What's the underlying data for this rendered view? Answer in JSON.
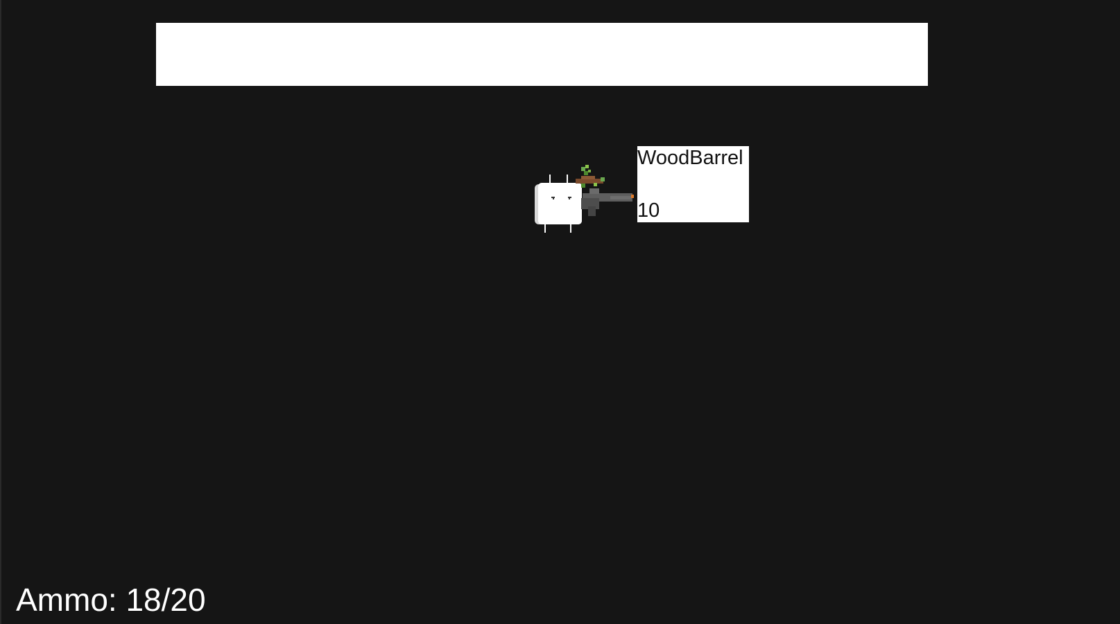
{
  "hud": {
    "ammo_label": "Ammo: 18/20"
  },
  "item_tooltip": {
    "name": "WoodBarrel",
    "value": "10"
  },
  "player": {
    "icon": "marshmallow-player-icon",
    "weapon_icon": "rifle-icon",
    "attachment_icon": "wood-barrel-branch-icon"
  },
  "colors": {
    "background": "#151515",
    "banner": "#ffffff",
    "tooltip_bg": "#ffffff",
    "hud_text": "#ffffff"
  }
}
